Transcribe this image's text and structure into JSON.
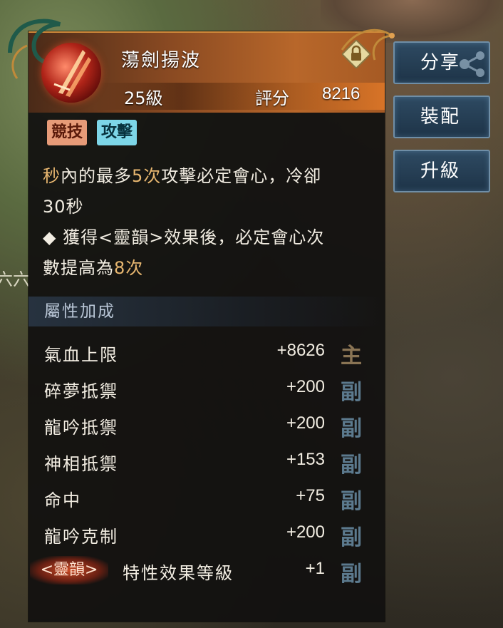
{
  "background": {
    "glyph": "六六"
  },
  "item": {
    "name": "蕩劍揚波",
    "level": "25級",
    "score_label": "評分",
    "score_value": "8216",
    "icon": "sword-emblem-icon",
    "locked_icon": "lock-icon",
    "tags": [
      "競技",
      "攻擊"
    ]
  },
  "description": {
    "line_partial": "",
    "line1_a": "秒",
    "line1_b": "內的最多",
    "line1_c": "5次",
    "line1_d": "攻擊必定會心，冷卻",
    "line2": "30秒",
    "line3": "◆ 獲得<靈韻>效果後，必定會心次",
    "line4_a": "數提高為",
    "line4_b": "8次"
  },
  "attributes_section": {
    "title": "屬性加成",
    "rows": [
      {
        "name": "氣血上限",
        "value": "+8626",
        "type": "主"
      },
      {
        "name": "碎夢抵禦",
        "value": "+200",
        "type": "副"
      },
      {
        "name": "龍吟抵禦",
        "value": "+200",
        "type": "副"
      },
      {
        "name": "神相抵禦",
        "value": "+153",
        "type": "副"
      },
      {
        "name": "命中",
        "value": "+75",
        "type": "副"
      },
      {
        "name": "龍吟克制",
        "value": "+200",
        "type": "副"
      }
    ],
    "special": {
      "tag": "<靈韻>",
      "name": "特性效果等級",
      "value": "+1",
      "type": "副"
    }
  },
  "actions": {
    "share": "分享",
    "equip": "裝配",
    "upgrade": "升級"
  },
  "colors": {
    "highlight": "#e8b770",
    "main_type": "#8a7454",
    "sub_type": "#5c7a8e",
    "header": "#b8672a"
  }
}
